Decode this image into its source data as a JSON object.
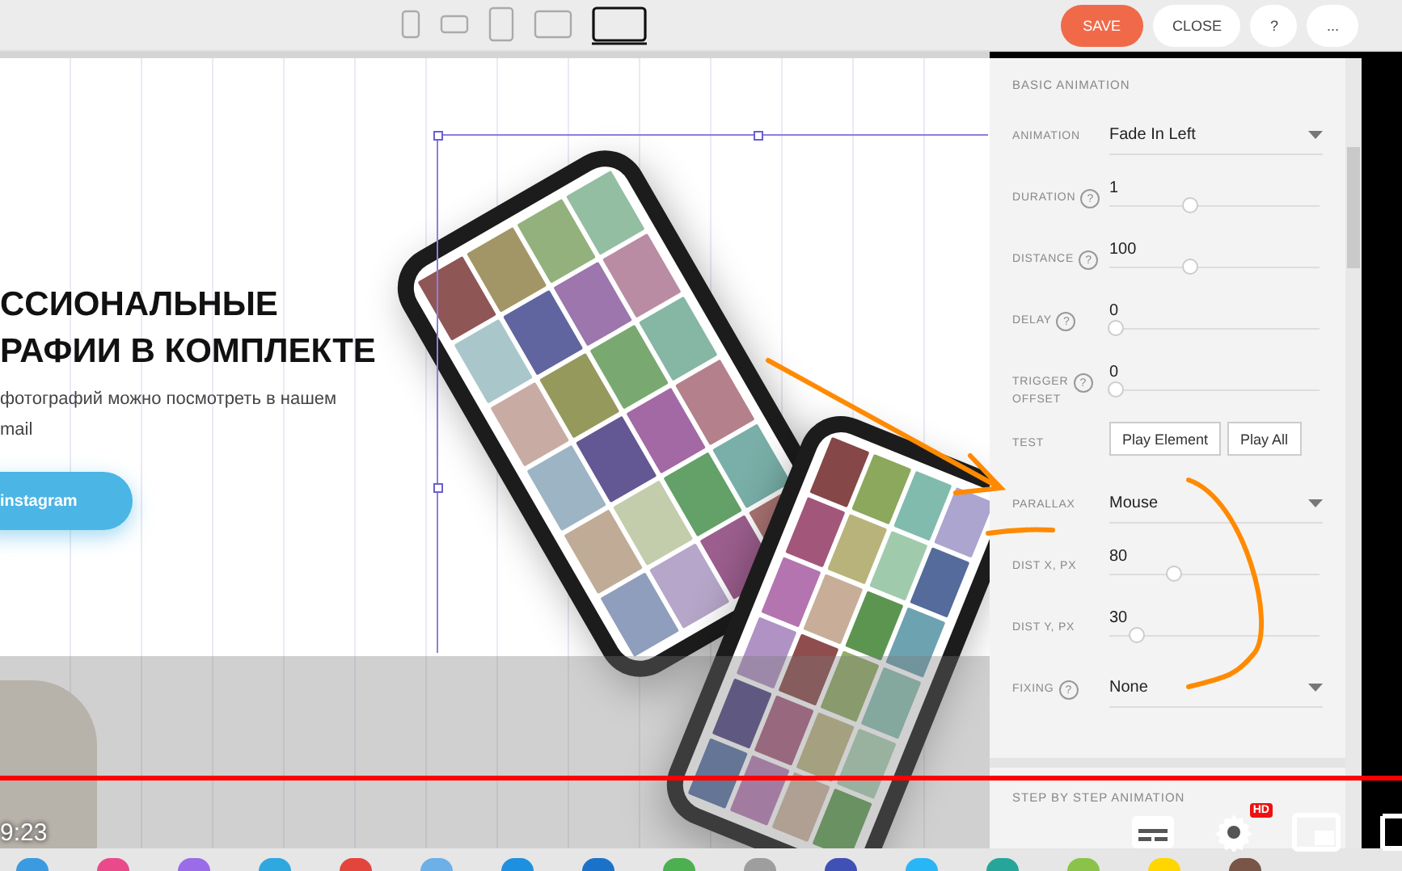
{
  "toolbar": {
    "devices": [
      {
        "kind": "phone",
        "selected": false
      },
      {
        "kind": "phone-landscape",
        "selected": false
      },
      {
        "kind": "tablet",
        "selected": false
      },
      {
        "kind": "tablet-landscape",
        "selected": false
      },
      {
        "kind": "laptop",
        "selected": true
      }
    ],
    "buttons": [
      {
        "label": "SAVE",
        "kind": "primary"
      },
      {
        "label": "CLOSE",
        "kind": "plain"
      },
      {
        "label": "?",
        "kind": "plain"
      },
      {
        "label": "...",
        "kind": "plain"
      }
    ]
  },
  "canvas": {
    "heading": "ССИОНАЛЬНЫЕ\nРАФИИ В КОМПЛЕКТЕ",
    "text": "фотографий можно посмотреть в нашем\nmail",
    "button": "instagram"
  },
  "panel": {
    "title": "BASIC ANIMATION",
    "rows": [
      {
        "kind": "select",
        "label": "ANIMATION",
        "value": "Fade In Left"
      },
      {
        "kind": "slider",
        "label": "DURATION",
        "help": "?",
        "value": "1",
        "level": 0.35
      },
      {
        "kind": "slider",
        "label": "DISTANCE",
        "help": "?",
        "value": "100",
        "level": 0.35
      },
      {
        "kind": "slider",
        "label": "DELAY",
        "help": "?",
        "value": "0",
        "level": 0
      },
      {
        "kind": "slider",
        "label": "TRIGGER\nOFFSET",
        "help": "?",
        "value": "0",
        "level": 0
      },
      {
        "kind": "buttons",
        "label": "TEST",
        "buttons": [
          "Play Element",
          "Play All"
        ]
      },
      {
        "kind": "select",
        "label": "PARALLAX",
        "value": "Mouse"
      },
      {
        "kind": "slider",
        "label": "DIST X, PX",
        "value": "80",
        "level": 0.28
      },
      {
        "kind": "slider",
        "label": "DIST Y, PX",
        "value": "30",
        "level": 0.1
      },
      {
        "kind": "select",
        "label": "FIXING",
        "help": "?",
        "value": "None"
      }
    ],
    "next_section": "STEP BY STEP ANIMATION"
  },
  "player": {
    "time": "9:23",
    "hd_badge": "HD",
    "progress": {
      "level": 1
    }
  }
}
